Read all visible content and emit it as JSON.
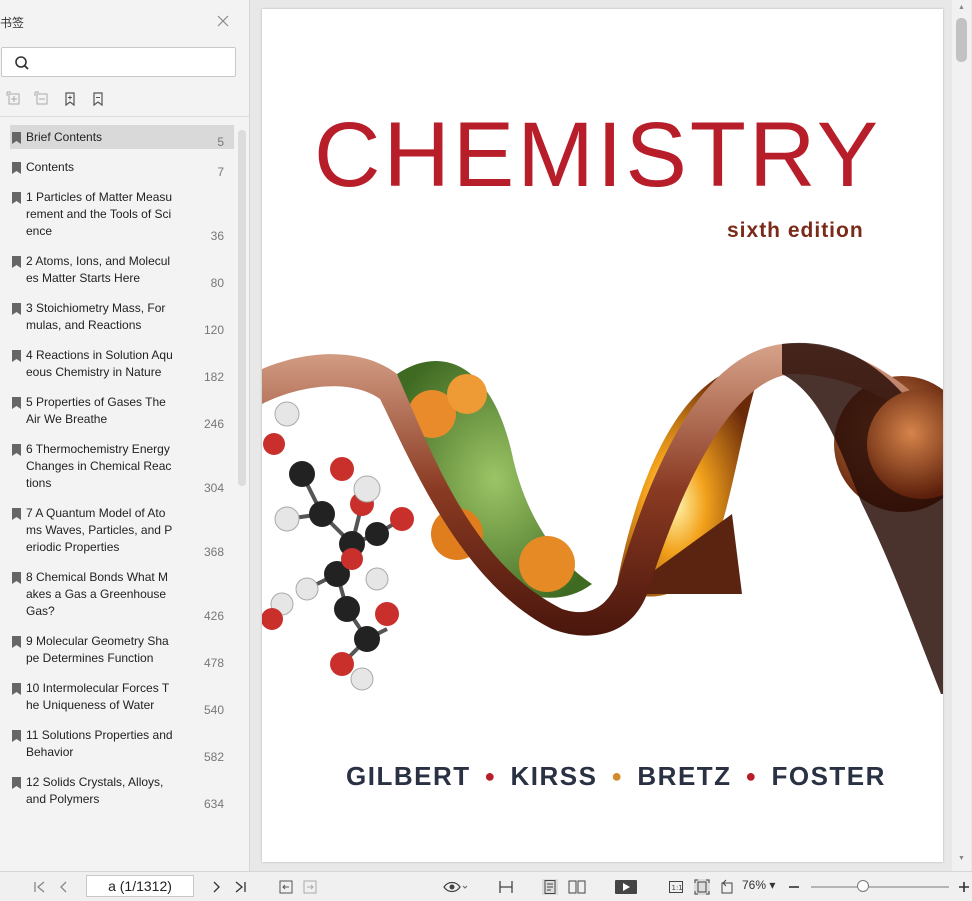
{
  "sidebar": {
    "title": "书签",
    "search": {
      "placeholder": "",
      "value": ""
    },
    "bookmarks": [
      {
        "label": "Brief Contents",
        "page": "5",
        "selected": true
      },
      {
        "label": "Contents",
        "page": "7"
      },
      {
        "label": "1 Particles of Matter  Measurement and the   Tools of Science",
        "page": "36"
      },
      {
        "label": "2 Atoms, Ions, and   Molecules  Matter Starts Here",
        "page": "80"
      },
      {
        "label": "3 Stoichiometry  Mass, Formulas,    and Reactions",
        "page": "120"
      },
      {
        "label": "4 Reactions in   Solution  Aqueous Chemistry   in Nature",
        "page": "182"
      },
      {
        "label": "5 Properties of Gases  The Air We Breathe",
        "page": "246"
      },
      {
        "label": "6 Thermochemistry  Energy Changes in    Chemical Reactions",
        "page": "304"
      },
      {
        "label": "7 A Quantum Model    of Atoms  Waves, Particles, and Periodic Properties",
        "page": "368"
      },
      {
        "label": "8 Chemical Bonds  What Makes a Gas    a Greenhouse Gas?",
        "page": "426"
      },
      {
        "label": "9 Molecular   Geometry  Shape Determines   Function",
        "page": "478"
      },
      {
        "label": "10 Intermolecular   Forces  The Uniqueness    of Water",
        "page": "540"
      },
      {
        "label": "11 Solutions  Properties and Behavior",
        "page": "582"
      },
      {
        "label": "12 Solids  Crystals, Alloys, and   Polymers",
        "page": "634"
      }
    ]
  },
  "document": {
    "cover": {
      "title": "CHEMISTRY",
      "subtitle": "sixth edition",
      "authors": [
        "GILBERT",
        "KIRSS",
        "BRETZ",
        "FOSTER"
      ]
    }
  },
  "toolbar": {
    "page_indicator": "a (1/1312)",
    "zoom": "76%",
    "zoom_level": 0.38
  }
}
